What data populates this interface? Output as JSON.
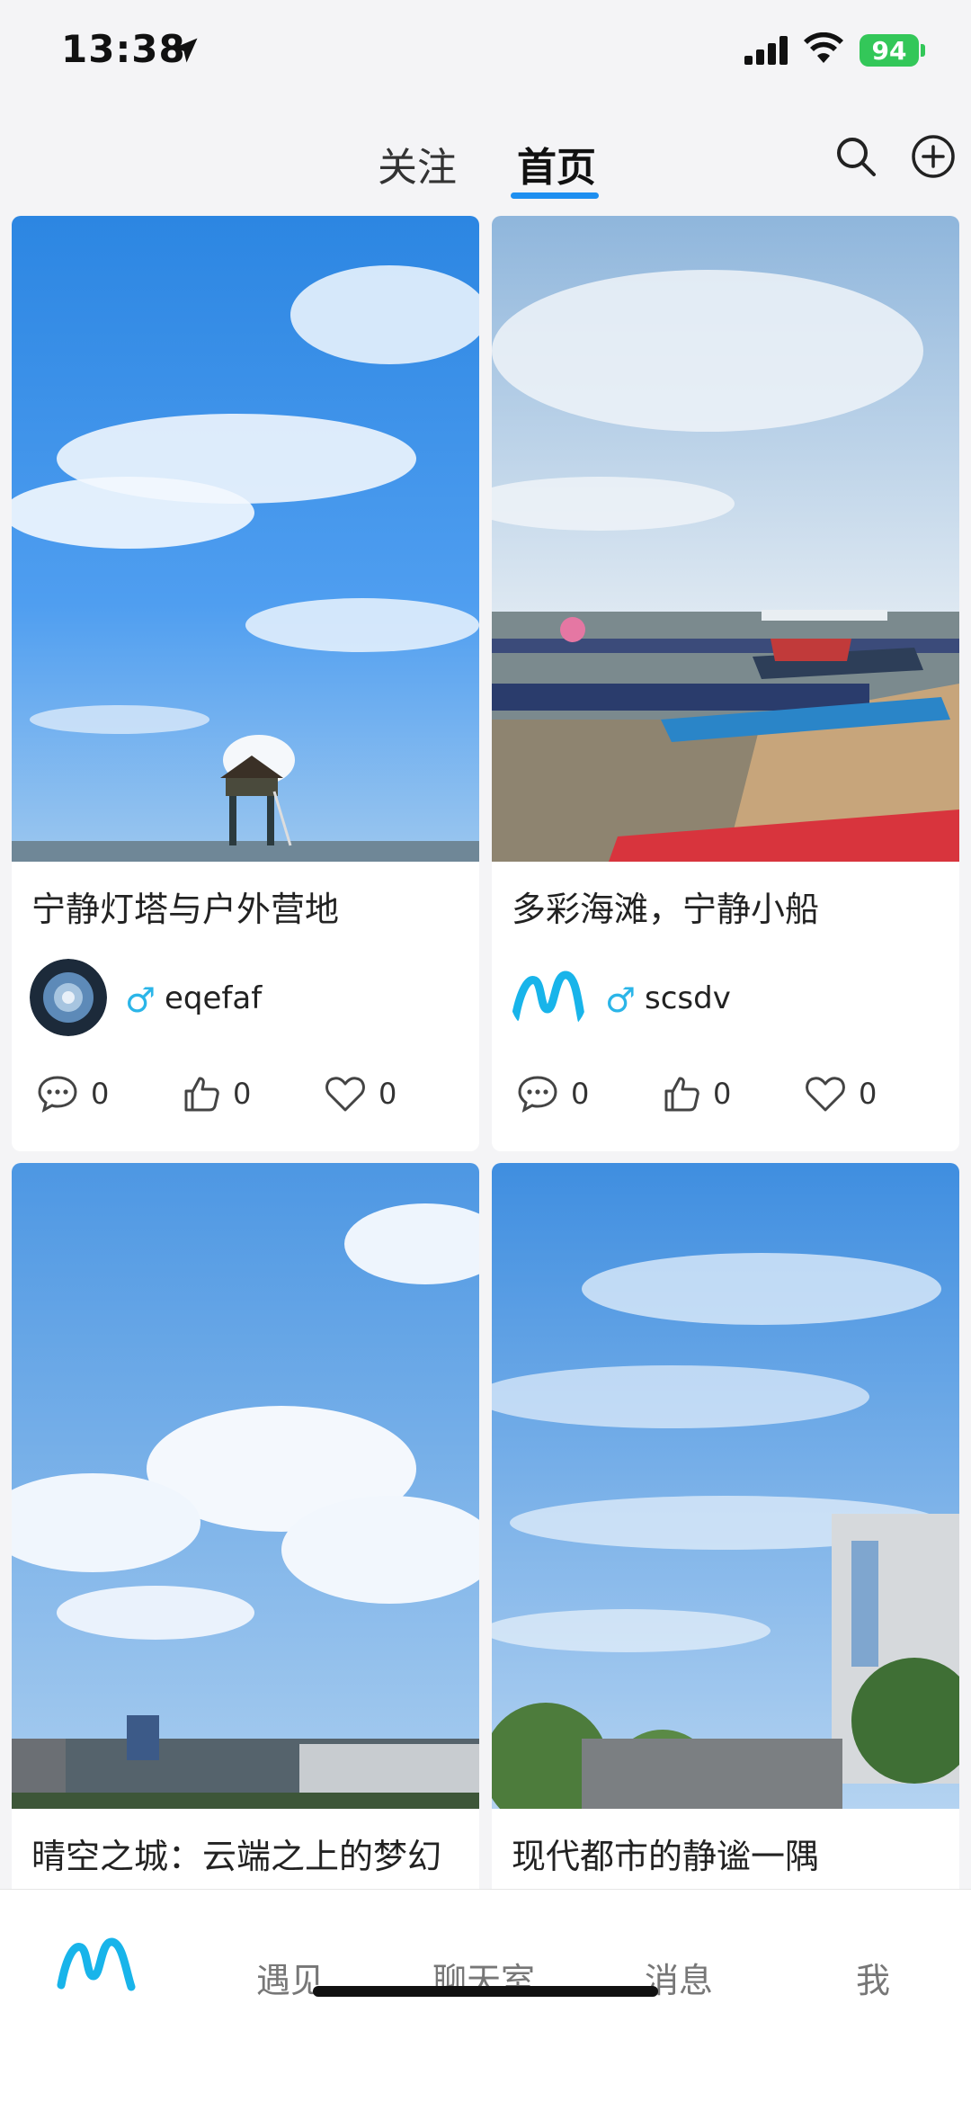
{
  "status_bar": {
    "time": "13:38",
    "battery": "94"
  },
  "top_tabs": {
    "follow": "关注",
    "home": "首页",
    "active": "home"
  },
  "icons": {
    "search": "search-icon",
    "add": "add-circle-icon",
    "comment": "comment-icon",
    "like": "thumbs-up-icon",
    "favorite": "heart-icon",
    "gender": "male-icon"
  },
  "colors": {
    "accent": "#1e8ff0",
    "gender": "#2bb5e8",
    "battery": "#33c759"
  },
  "posts": [
    {
      "title": "宁静灯塔与户外营地",
      "gender": "♂",
      "author": "eqefaf",
      "comments": "0",
      "likes": "0",
      "favorites": "0"
    },
    {
      "title": "多彩海滩，宁静小船",
      "gender": "♂",
      "author": "scsdv",
      "comments": "0",
      "likes": "0",
      "favorites": "0"
    },
    {
      "title": "晴空之城：云端之上的梦幻"
    },
    {
      "title": "现代都市的静谧一隅"
    }
  ],
  "bottom_nav": {
    "meet": "遇见",
    "chat": "聊天室",
    "messages": "消息",
    "me": "我"
  }
}
